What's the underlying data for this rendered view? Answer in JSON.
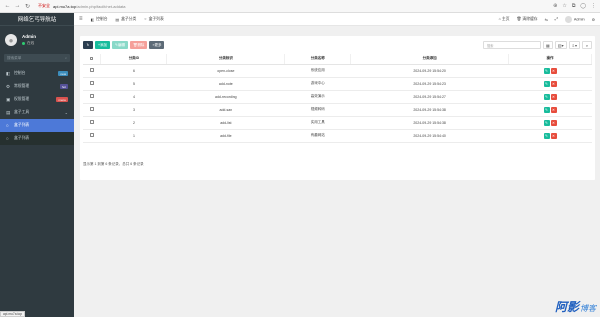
{
  "browser": {
    "security_warning": "不安全",
    "host": "api.mu7a.top",
    "path": "/admin.php/facilt/net-addata"
  },
  "sidebar": {
    "brand": "网络乞丐导航站",
    "user_name": "Admin",
    "user_status": "在线",
    "search_placeholder": "搜索菜单",
    "items": [
      {
        "label": "控制台",
        "icon": "dashboard-icon",
        "badge": "new"
      },
      {
        "label": "常规管理",
        "icon": "gear-icon",
        "badge": "hot"
      },
      {
        "label": "权限管理",
        "icon": "group-icon",
        "badge": "menu"
      },
      {
        "label": "盒子工具",
        "icon": "box-icon",
        "badge": ""
      }
    ],
    "sub_items": [
      {
        "label": "盒子列表",
        "icon": "circle-icon"
      },
      {
        "label": "盒子列表",
        "icon": "circle-icon"
      }
    ]
  },
  "topbar": {
    "tabs": [
      {
        "label": "控制台",
        "icon": "dashboard-icon"
      },
      {
        "label": "盒子分类",
        "icon": "box-icon"
      },
      {
        "label": "盒子列表",
        "icon": "circle-icon"
      }
    ],
    "home": "主页",
    "clear_cache": "清除缓存",
    "admin": "Admin"
  },
  "toolbar": {
    "add": "添加",
    "edit": "编辑",
    "delete": "删除",
    "more": "更多",
    "search_placeholder": "搜索"
  },
  "table": {
    "headers": [
      "",
      "分类ID",
      "分类标识",
      "分类名称",
      "分类添加",
      "操作"
    ],
    "rows": [
      {
        "id": "6",
        "ident": "open-close",
        "name": "系统应用",
        "added": "2024-09-29 15:54:20"
      },
      {
        "id": "5",
        "ident": "add-note",
        "name": "游戏中心",
        "added": "2024-09-29 15:54:23"
      },
      {
        "id": "4",
        "ident": "add-recording",
        "name": "高效演示",
        "added": "2024-09-29 15:54:27"
      },
      {
        "id": "3",
        "ident": "add-san",
        "name": "视频转码",
        "added": "2024-09-29 15:54:38"
      },
      {
        "id": "2",
        "ident": "add-list",
        "name": "实用工具",
        "added": "2024-09-29 15:54:38"
      },
      {
        "id": "1",
        "ident": "add-file",
        "name": "有趣网站",
        "added": "2024-09-29 15:54:40"
      }
    ],
    "footer": "显示第 1 到第 6 条记录，总共 6 条记录"
  },
  "status_bar": "api.mu7a.top",
  "watermark": {
    "main": "阿影",
    "sub": "博客"
  }
}
